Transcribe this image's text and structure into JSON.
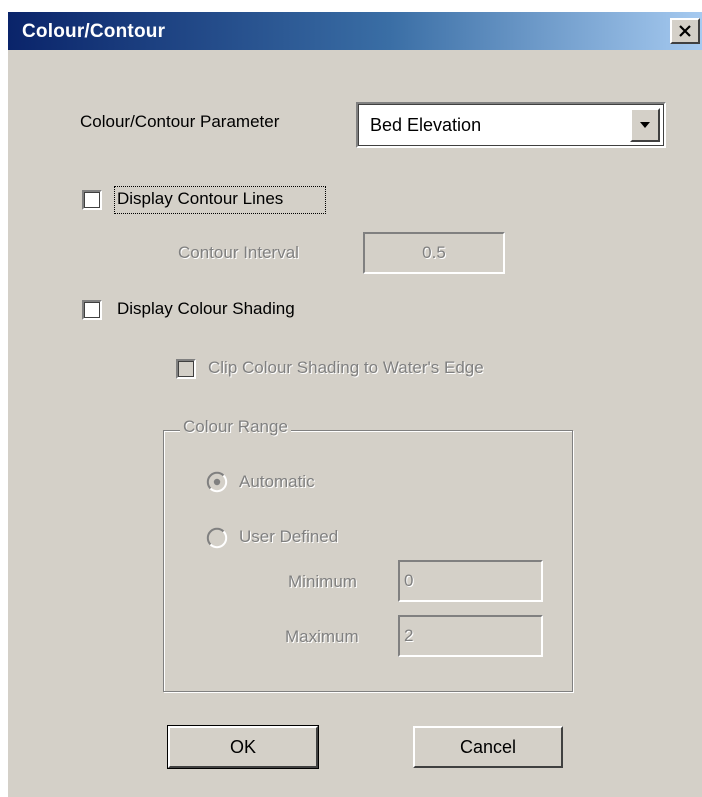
{
  "window": {
    "title": "Colour/Contour",
    "close_glyph": "✕"
  },
  "parameter": {
    "label": "Colour/Contour Parameter",
    "selected": "Bed Elevation"
  },
  "contour_lines": {
    "label": "Display Contour Lines",
    "checked": false
  },
  "contour_interval": {
    "label": "Contour Interval",
    "value": "0.5"
  },
  "colour_shading": {
    "label": "Display Colour Shading",
    "checked": false
  },
  "clip_shading": {
    "label": "Clip Colour Shading to Water's Edge",
    "checked": false
  },
  "colour_range": {
    "legend": "Colour Range",
    "automatic_label": "Automatic",
    "user_defined_label": "User Defined",
    "selected": "Automatic",
    "minimum_label": "Minimum",
    "minimum_value": "0",
    "maximum_label": "Maximum",
    "maximum_value": "2"
  },
  "buttons": {
    "ok": "OK",
    "cancel": "Cancel"
  },
  "colors": {
    "face": "#d4d0c8",
    "title_start": "#0a246a",
    "title_end": "#a6caf0",
    "disabled_text": "#808080"
  },
  "icons": {
    "close": "close-icon",
    "dropdown": "chevron-down-icon"
  }
}
